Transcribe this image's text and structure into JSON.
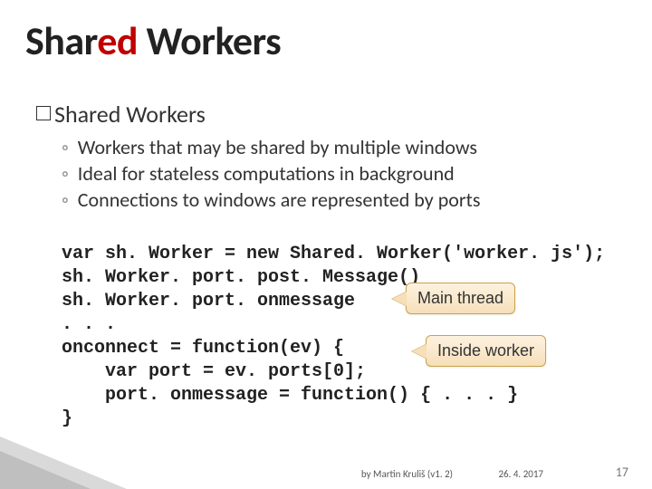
{
  "title": {
    "word1": "Shar",
    "word1b": "ed",
    "word2": " Workers"
  },
  "section": "Shared Workers",
  "bullets": [
    "Workers that may be shared by multiple windows",
    "Ideal for stateless computations in background",
    "Connections to windows are represented by ports"
  ],
  "code": [
    "var sh. Worker = new Shared. Worker('worker. js');",
    "sh. Worker. port. post. Message()",
    "sh. Worker. port. onmessage",
    ". . .",
    "onconnect = function(ev) {",
    "    var port = ev. ports[0];",
    "    port. onmessage = function() { . . . }",
    "}"
  ],
  "callouts": {
    "main": "Main thread",
    "worker": "Inside worker"
  },
  "footer": {
    "credit": "by Martin Kruliš (v1. 2)",
    "date": "26. 4. 2017",
    "page": "17"
  }
}
